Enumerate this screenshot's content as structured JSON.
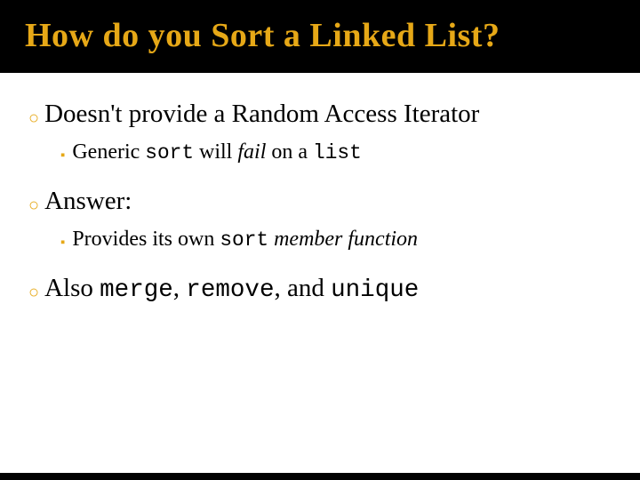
{
  "title": "How do you Sort a Linked List?",
  "bullets": [
    {
      "text_parts": [
        {
          "t": "Doesn't provide a Random Access Iterator",
          "cls": ""
        }
      ],
      "sub": [
        {
          "text_parts": [
            {
              "t": "Generic ",
              "cls": ""
            },
            {
              "t": "sort",
              "cls": "code"
            },
            {
              "t": " will ",
              "cls": ""
            },
            {
              "t": "fail",
              "cls": "italic"
            },
            {
              "t": " on a ",
              "cls": ""
            },
            {
              "t": "list",
              "cls": "code"
            }
          ]
        }
      ]
    },
    {
      "text_parts": [
        {
          "t": "Answer:",
          "cls": ""
        }
      ],
      "sub": [
        {
          "text_parts": [
            {
              "t": "Provides its own ",
              "cls": ""
            },
            {
              "t": "sort",
              "cls": "code"
            },
            {
              "t": " ",
              "cls": ""
            },
            {
              "t": "member function",
              "cls": "italic"
            }
          ]
        }
      ]
    },
    {
      "text_parts": [
        {
          "t": "Also ",
          "cls": ""
        },
        {
          "t": "merge",
          "cls": "code"
        },
        {
          "t": ", ",
          "cls": ""
        },
        {
          "t": "remove",
          "cls": "code"
        },
        {
          "t": ", and ",
          "cls": ""
        },
        {
          "t": "unique",
          "cls": "code"
        }
      ],
      "sub": []
    }
  ]
}
